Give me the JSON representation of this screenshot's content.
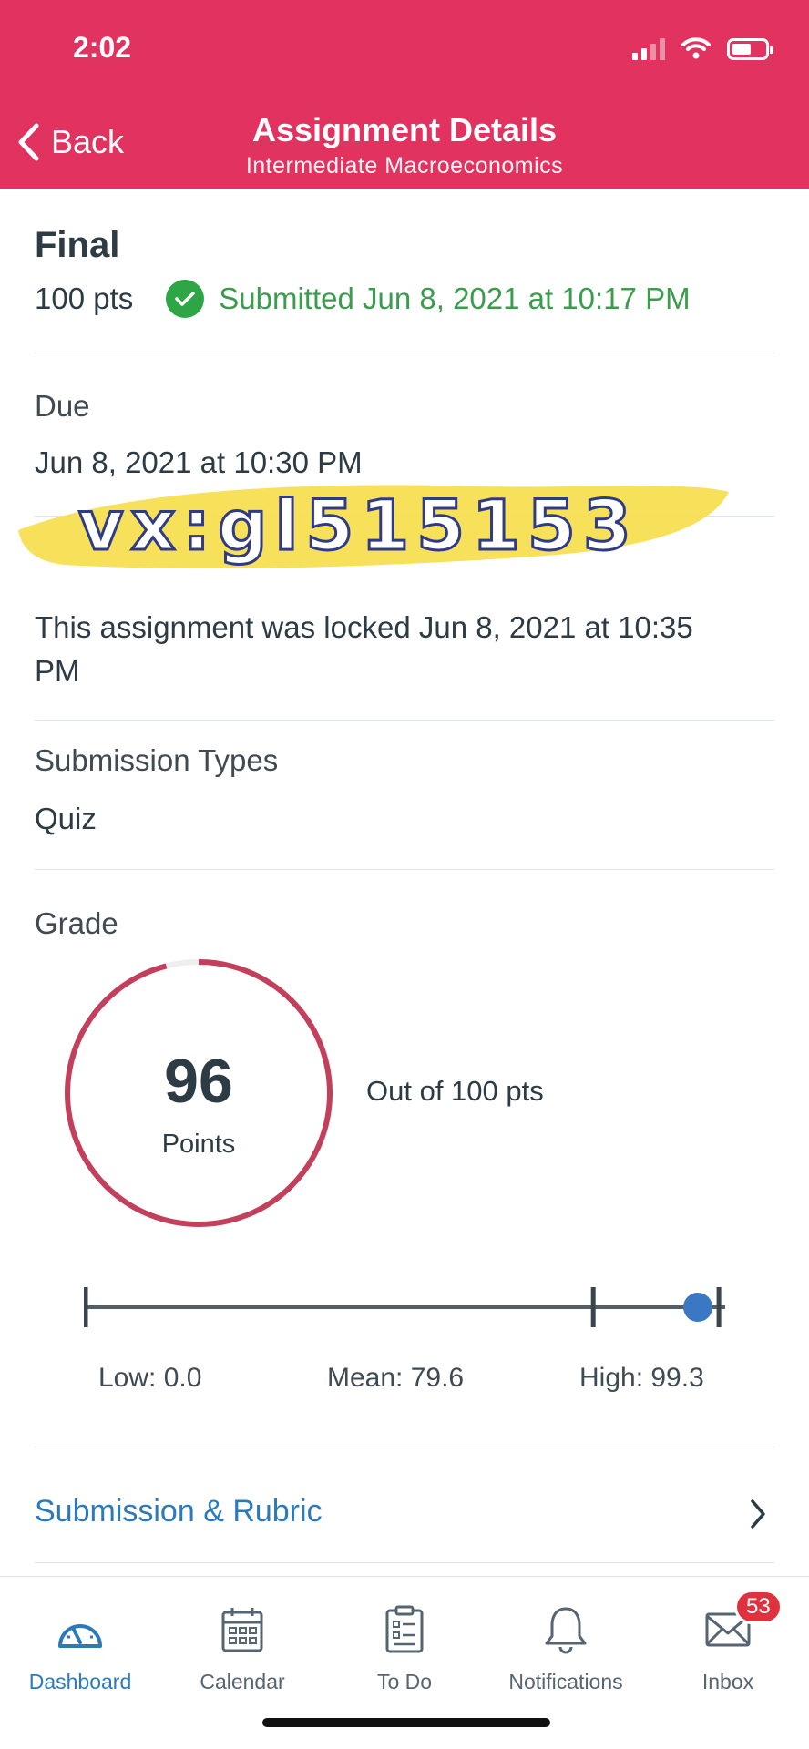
{
  "status_bar": {
    "time": "2:02"
  },
  "header": {
    "back_label": "Back",
    "title": "Assignment Details",
    "subtitle": "Intermediate Macroeconomics"
  },
  "assignment": {
    "name": "Final",
    "points": "100 pts",
    "submitted": "Submitted Jun 8, 2021 at 10:17 PM"
  },
  "due": {
    "label": "Due",
    "value": "Jun 8, 2021 at 10:30 PM"
  },
  "lock": {
    "text_line1": "This assignment was locked Jun 8, 2021 at 10:35",
    "text_line2": "PM"
  },
  "submission_types": {
    "label": "Submission Types",
    "value": "Quiz"
  },
  "grade": {
    "label": "Grade",
    "score": "96",
    "score_unit": "Points",
    "out_of": "Out of 100 pts",
    "score_fraction": 0.96,
    "stats": {
      "low": "Low: 0.0",
      "mean": "Mean: 79.6",
      "high": "High: 99.3"
    },
    "stats_values": {
      "low": 0.0,
      "mean": 79.6,
      "high": 99.3,
      "score": 96
    }
  },
  "watermark": {
    "text": "vx:gl515153"
  },
  "rubric": {
    "label": "Submission & Rubric"
  },
  "tabbar": {
    "items": [
      {
        "label": "Dashboard",
        "icon": "dashboard-icon"
      },
      {
        "label": "Calendar",
        "icon": "calendar-icon"
      },
      {
        "label": "To Do",
        "icon": "todo-icon"
      },
      {
        "label": "Notifications",
        "icon": "bell-icon"
      },
      {
        "label": "Inbox",
        "icon": "inbox-icon",
        "badge": "53"
      }
    ]
  },
  "colors": {
    "brand": "#e2325f",
    "success": "#3a9d4c",
    "link": "#2b7abc",
    "ring": "#c2405c",
    "badge": "#e0323e"
  }
}
